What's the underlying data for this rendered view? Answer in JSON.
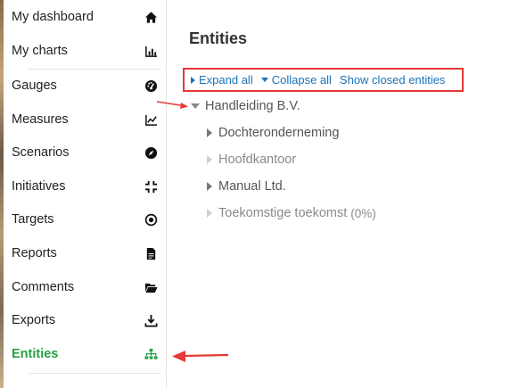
{
  "sidebar": {
    "items": [
      {
        "label": "My dashboard",
        "icon": "home-icon"
      },
      {
        "label": "My charts",
        "icon": "bar-chart-icon"
      },
      {
        "label": "Gauges",
        "icon": "gauge-icon"
      },
      {
        "label": "Measures",
        "icon": "line-chart-icon"
      },
      {
        "label": "Scenarios",
        "icon": "compass-icon"
      },
      {
        "label": "Initiatives",
        "icon": "compress-icon"
      },
      {
        "label": "Targets",
        "icon": "target-icon"
      },
      {
        "label": "Reports",
        "icon": "file-icon"
      },
      {
        "label": "Comments",
        "icon": "folder-open-icon"
      },
      {
        "label": "Exports",
        "icon": "download-icon"
      },
      {
        "label": "Entities",
        "icon": "sitemap-icon",
        "active": true
      }
    ],
    "active_color": "#27a044"
  },
  "main": {
    "title": "Entities",
    "toolbar": {
      "expand_all": "Expand all",
      "collapse_all": "Collapse all",
      "show_closed": "Show closed entities"
    },
    "tree": {
      "root": "Handleiding B.V.",
      "children": [
        {
          "label": "Dochteronderneming",
          "expandable": true
        },
        {
          "label": "Hoofdkantoor",
          "expandable": false
        },
        {
          "label": "Manual Ltd.",
          "expandable": true
        },
        {
          "label": "Toekomstige toekomst",
          "extra": "(0%)",
          "expandable": false
        }
      ]
    }
  },
  "colors": {
    "link": "#1a73b8",
    "highlight_border": "#e53935",
    "annotation_arrow": "#e53935"
  }
}
